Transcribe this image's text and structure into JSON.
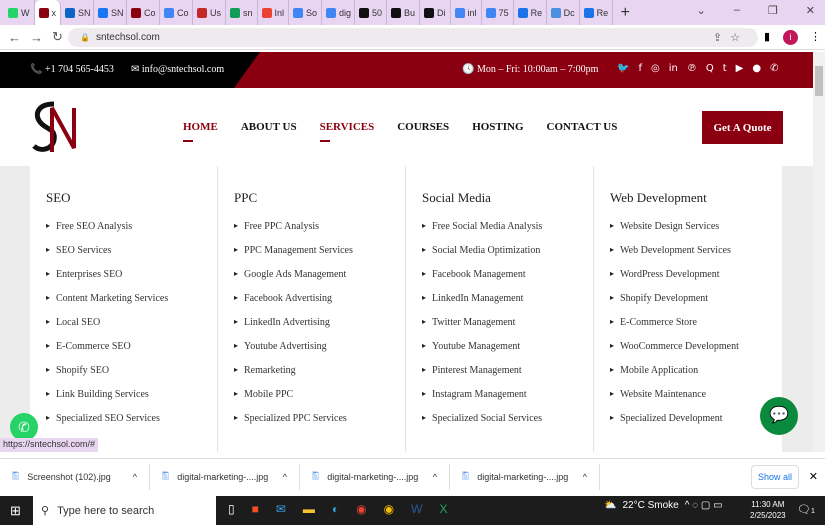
{
  "browser": {
    "tabs": [
      {
        "label": "W",
        "color": "#25d366"
      },
      {
        "label": "x",
        "color": "#8a0010"
      },
      {
        "label": "SN",
        "color": "#0a66c2"
      },
      {
        "label": "SN",
        "color": "#1877f2"
      },
      {
        "label": "Co",
        "color": "#8a0010"
      },
      {
        "label": "Co",
        "color": "#4285f4"
      },
      {
        "label": "Us",
        "color": "#c62828"
      },
      {
        "label": "sn",
        "color": "#0f9d58"
      },
      {
        "label": "Inl",
        "color": "#ea4335"
      },
      {
        "label": "So",
        "color": "#4285f4"
      },
      {
        "label": "dig",
        "color": "#4285f4"
      },
      {
        "label": "50",
        "color": "#111"
      },
      {
        "label": "Bu",
        "color": "#111"
      },
      {
        "label": "Di",
        "color": "#111"
      },
      {
        "label": "inl",
        "color": "#4285f4"
      },
      {
        "label": "75",
        "color": "#4285f4"
      },
      {
        "label": "Re",
        "color": "#1a73e8"
      },
      {
        "label": "Dc",
        "color": "#4a90e2"
      },
      {
        "label": "Re",
        "color": "#1a73e8"
      }
    ],
    "url": "sntechsol.com",
    "status_url": "https://sntechsol.com/#",
    "profile": "i"
  },
  "topbar": {
    "phone": "+1 704 565-4453",
    "email": "info@sntechsol.com",
    "hours": "Mon – Fri: 10:00am – 7:00pm",
    "social": [
      "twitter",
      "facebook",
      "instagram",
      "linkedin",
      "pinterest",
      "quora",
      "tumblr",
      "youtube",
      "reddit",
      "whatsapp"
    ]
  },
  "nav": {
    "items": [
      "HOME",
      "ABOUT US",
      "SERVICES",
      "COURSES",
      "HOSTING",
      "CONTACT US"
    ],
    "cta": "Get A Quote"
  },
  "mega": [
    {
      "title": "SEO",
      "items": [
        "Free SEO Analysis",
        "SEO Services",
        "Enterprises SEO",
        "Content Marketing Services",
        "Local SEO",
        "E-Commerce SEO",
        "Shopify SEO",
        "Link Building Services",
        "Specialized SEO Services"
      ]
    },
    {
      "title": "PPC",
      "items": [
        "Free PPC Analysis",
        "PPC Management Services",
        "Google Ads Management",
        "Facebook Advertising",
        "LinkedIn Advertising",
        "Youtube Advertising",
        "Remarketing",
        "Mobile PPC",
        "Specialized PPC Services"
      ]
    },
    {
      "title": "Social Media",
      "items": [
        "Free Social Media Analysis",
        "Social Media Optimization",
        "Facebook Management",
        "LinkedIn Management",
        "Twitter Management",
        "Youtube Management",
        "Pinterest Management",
        "Instagram Management",
        "Specialized Social Services"
      ]
    },
    {
      "title": "Web Development",
      "items": [
        "Website Design Services",
        "Web Development Services",
        "WordPress Development",
        "Shopify Development",
        "E-Commerce Store",
        "WooCommerce Development",
        "Mobile Application",
        "Website Maintenance",
        "Specialized Development"
      ]
    }
  ],
  "downloads": {
    "items": [
      "Screenshot (102).jpg",
      "digital-marketing-....jpg",
      "digital-marketing-....jpg",
      "digital-marketing-....jpg"
    ],
    "show_all": "Show all"
  },
  "taskbar": {
    "search_placeholder": "Type here to search",
    "weather": "22°C  Smoke",
    "time": "11:30 AM",
    "date": "2/25/2023",
    "notifications": "1"
  }
}
